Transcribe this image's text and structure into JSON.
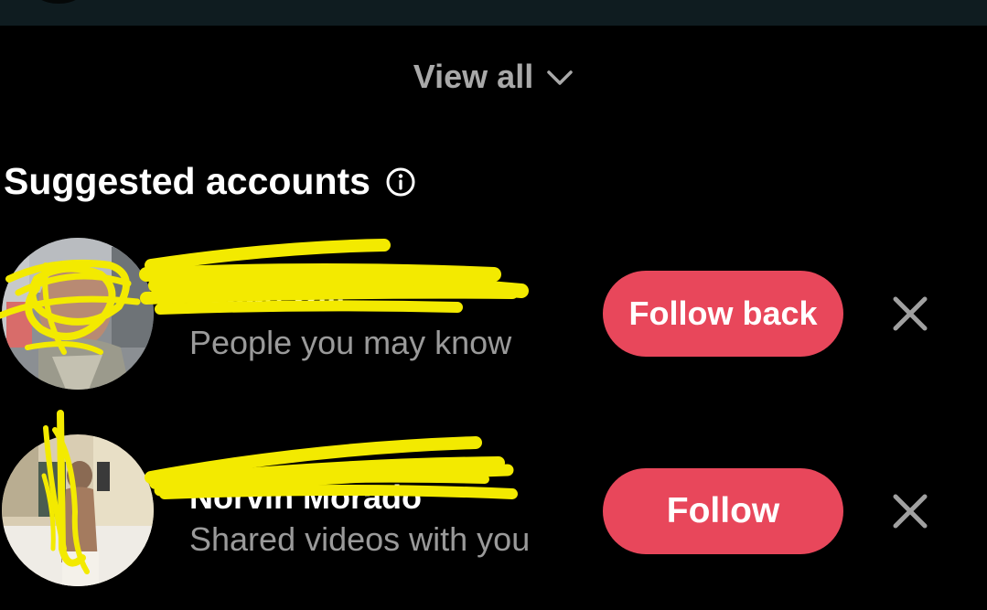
{
  "view_all": {
    "label": "View all",
    "chevron_icon": "chevron-down-icon"
  },
  "section": {
    "title": "Suggested accounts",
    "info_icon": "info-circle-icon"
  },
  "accounts": [
    {
      "name": "Jesus O...",
      "subtitle": "People you may know",
      "button_label": "Follow back",
      "dismiss_icon": "close-icon"
    },
    {
      "name": "Norvin Morado",
      "subtitle": "Shared videos with you",
      "button_label": "Follow",
      "dismiss_icon": "close-icon"
    }
  ],
  "colors": {
    "background": "#000000",
    "top_bar": "#0f1c20",
    "follow_button": "#e8475b",
    "muted_text": "#9a9a9a",
    "view_all_text": "#a9a9a9",
    "redaction_marker": "#f3ea00"
  }
}
